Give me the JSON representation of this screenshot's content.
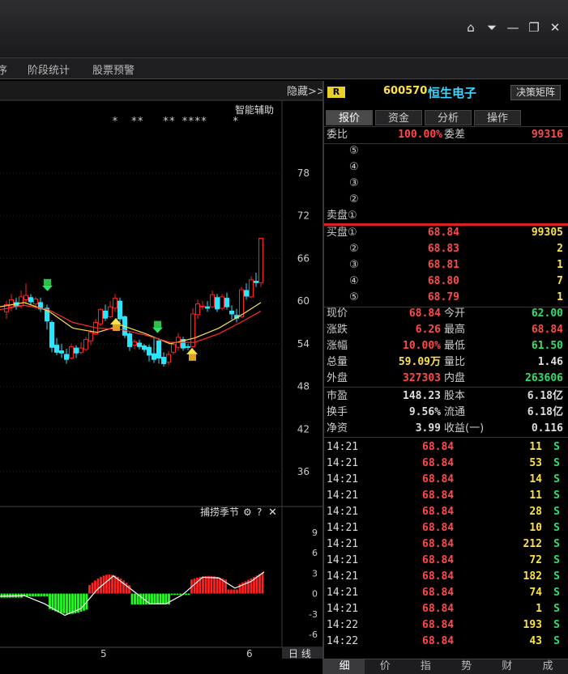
{
  "window": {
    "controls": [
      "⌂",
      "⏷",
      "—",
      "❐",
      "✕"
    ]
  },
  "tabs": {
    "items": [
      "序",
      "阶段统计",
      "股票预警"
    ]
  },
  "chart": {
    "hide_label": "隐藏>>",
    "assist_label": "智能辅助",
    "star_markers": "*  **   ** ****    *",
    "price_ticks": [
      "78",
      "72",
      "66",
      "60",
      "54",
      "48",
      "42",
      "36"
    ],
    "indicator_title": "捕捞季节",
    "indicator_ticks": [
      "9",
      "6",
      "3",
      "0",
      "-3",
      "-6"
    ],
    "date_labels": [
      "5",
      "6"
    ],
    "period_label": "日 线",
    "colors": {
      "up": "#ff2020",
      "down": "#29e6ff",
      "ma_short": "#ffffff",
      "ma_yellow": "#ffe14a",
      "ma_red": "#ff2a2a",
      "hist_green": "#20ff20"
    }
  },
  "stock": {
    "badge": "R",
    "code": "600570",
    "name": "恒生电子",
    "decision_button": "决策矩阵"
  },
  "quote_tabs": [
    "报价",
    "资金",
    "分析",
    "操作"
  ],
  "order": {
    "weibi_label": "委比",
    "weibi_value": "100.00%",
    "weicha_label": "委差",
    "weicha_value": "99316",
    "sell": [
      {
        "label": "⑤",
        "price": "",
        "vol": ""
      },
      {
        "label": "④",
        "price": "",
        "vol": ""
      },
      {
        "label": "③",
        "price": "",
        "vol": ""
      },
      {
        "label": "②",
        "price": "",
        "vol": ""
      },
      {
        "label": "卖盘①",
        "price": "",
        "vol": ""
      }
    ],
    "buy": [
      {
        "label": "买盘①",
        "price": "68.84",
        "vol": "99305"
      },
      {
        "label": "②",
        "price": "68.83",
        "vol": "2"
      },
      {
        "label": "③",
        "price": "68.81",
        "vol": "1"
      },
      {
        "label": "④",
        "price": "68.80",
        "vol": "7"
      },
      {
        "label": "⑤",
        "price": "68.79",
        "vol": "1"
      }
    ]
  },
  "stats": [
    {
      "l1": "现价",
      "v1": "68.84",
      "c1": "red",
      "l2": "今开",
      "v2": "62.00",
      "c2": "green"
    },
    {
      "l1": "涨跌",
      "v1": "6.26",
      "c1": "red",
      "l2": "最高",
      "v2": "68.84",
      "c2": "red"
    },
    {
      "l1": "涨幅",
      "v1": "10.00%",
      "c1": "red",
      "l2": "最低",
      "v2": "61.50",
      "c2": "green"
    },
    {
      "l1": "总量",
      "v1": "59.09万",
      "c1": "yellow",
      "l2": "量比",
      "v2": "1.46",
      "c2": "white"
    },
    {
      "l1": "外盘",
      "v1": "327303",
      "c1": "red",
      "l2": "内盘",
      "v2": "263606",
      "c2": "green"
    },
    {
      "l1": "市盈",
      "v1": "148.23",
      "c1": "white",
      "l2": "股本",
      "v2": "6.18亿",
      "c2": "white"
    },
    {
      "l1": "换手",
      "v1": "9.56%",
      "c1": "white",
      "l2": "流通",
      "v2": "6.18亿",
      "c2": "white"
    },
    {
      "l1": "净资",
      "v1": "3.99",
      "c1": "white",
      "l2": "收益(一)",
      "v2": "0.116",
      "c2": "white"
    }
  ],
  "ticks": [
    {
      "time": "14:21",
      "price": "68.84",
      "vol": "11",
      "side": "S"
    },
    {
      "time": "14:21",
      "price": "68.84",
      "vol": "53",
      "side": "S"
    },
    {
      "time": "14:21",
      "price": "68.84",
      "vol": "14",
      "side": "S"
    },
    {
      "time": "14:21",
      "price": "68.84",
      "vol": "11",
      "side": "S"
    },
    {
      "time": "14:21",
      "price": "68.84",
      "vol": "28",
      "side": "S"
    },
    {
      "time": "14:21",
      "price": "68.84",
      "vol": "10",
      "side": "S"
    },
    {
      "time": "14:21",
      "price": "68.84",
      "vol": "212",
      "side": "S"
    },
    {
      "time": "14:21",
      "price": "68.84",
      "vol": "72",
      "side": "S"
    },
    {
      "time": "14:21",
      "price": "68.84",
      "vol": "182",
      "side": "S"
    },
    {
      "time": "14:21",
      "price": "68.84",
      "vol": "74",
      "side": "S"
    },
    {
      "time": "14:21",
      "price": "68.84",
      "vol": "1",
      "side": "S"
    },
    {
      "time": "14:22",
      "price": "68.84",
      "vol": "193",
      "side": "S"
    },
    {
      "time": "14:22",
      "price": "68.84",
      "vol": "43",
      "side": "S"
    }
  ],
  "bottom_tabs": [
    "细",
    "价",
    "指",
    "势",
    "财",
    "成"
  ]
}
